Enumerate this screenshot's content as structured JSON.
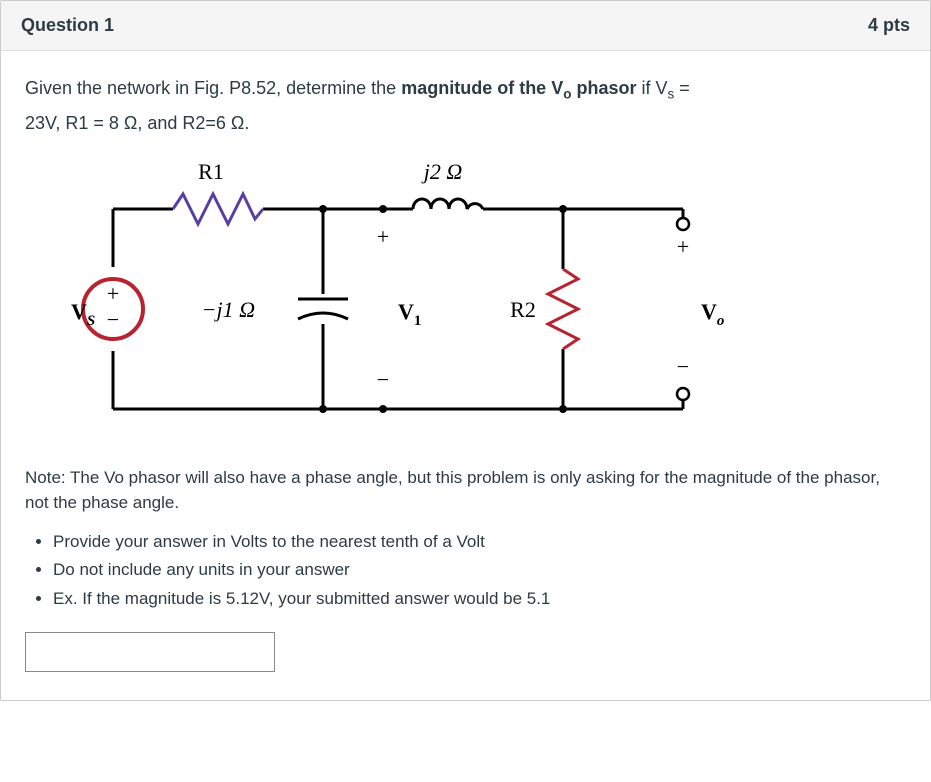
{
  "header": {
    "title": "Question 1",
    "points": "4 pts"
  },
  "prompt": {
    "line1a": "Given the network in Fig. P8.52, determine the ",
    "line1bold": "magnitude of the V",
    "line1bold_sub": "o",
    "line1bold_tail": " phasor",
    "line1b": " if V",
    "line1sub": "s",
    "line1c": " =",
    "line2": "23V, R1 = 8 Ω, and R2=6 Ω."
  },
  "circuit": {
    "Vs_label": "V",
    "Vs_sub": "S",
    "R1": "R1",
    "j2": "j2 Ω",
    "neg_j1": "−j1 Ω",
    "V1": "V",
    "V1_sub": "1",
    "R2": "R2",
    "Vo": "V",
    "Vo_sub": "o",
    "plus": "+",
    "minus": "−",
    "pm_plus": "+",
    "pm_minus": "−"
  },
  "note": {
    "text": "Note: The Vo phasor will also have a phase angle, but this problem is only asking for the magnitude of the phasor, not the phase angle."
  },
  "instructions": {
    "i1": "Provide your answer in Volts to the nearest tenth of a Volt",
    "i2": "Do not include any units in your answer",
    "i3": "Ex. If the magnitude is 5.12V, your submitted answer would be 5.1"
  },
  "answer": {
    "value": ""
  }
}
